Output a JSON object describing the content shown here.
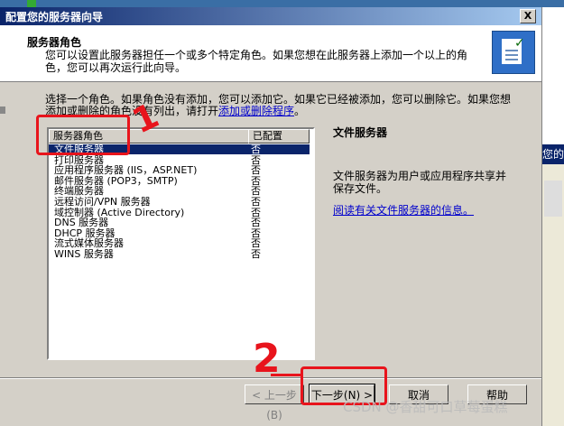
{
  "window": {
    "title": "配置您的服务器向导",
    "close_label": "X"
  },
  "header": {
    "title": "服务器角色",
    "description": "您可以设置此服务器担任一个或多个特定角色。如果您想在此服务器上添加一个以上的角色，您可以再次运行此向导。"
  },
  "intro": {
    "text_before_link": "选择一个角色。如果角色没有添加，您可以添加它。如果它已经被添加，您可以删除它。如果您想添加或删除的角色没有列出，请打开",
    "link_text": "添加或删除程序",
    "text_after_link": "。"
  },
  "roles_list": {
    "col_role": "服务器角色",
    "col_configured": "已配置",
    "rows": [
      {
        "role": "文件服务器",
        "configured": "否"
      },
      {
        "role": "打印服务器",
        "configured": "否"
      },
      {
        "role": "应用程序服务器 (IIS，ASP.NET)",
        "configured": "否"
      },
      {
        "role": "邮件服务器 (POP3，SMTP)",
        "configured": "否"
      },
      {
        "role": "终端服务器",
        "configured": "否"
      },
      {
        "role": "远程访问/VPN 服务器",
        "configured": "否"
      },
      {
        "role": "域控制器 (Active Directory)",
        "configured": "否"
      },
      {
        "role": "DNS 服务器",
        "configured": "否"
      },
      {
        "role": "DHCP 服务器",
        "configured": "否"
      },
      {
        "role": "流式媒体服务器",
        "configured": "否"
      },
      {
        "role": "WINS 服务器",
        "configured": "否"
      }
    ]
  },
  "detail": {
    "title": "文件服务器",
    "description": "文件服务器为用户或应用程序共享并保存文件。",
    "link": "阅读有关文件服务器的信息。"
  },
  "buttons": {
    "back": "< 上一步(B)",
    "next": "下一步(N) >",
    "cancel": "取消",
    "help": "帮助"
  },
  "annotations": {
    "step1": "1",
    "step2": "2"
  },
  "watermark": "CSDN @香甜可口草莓蛋糕",
  "background_window": {
    "title": "您的"
  },
  "colors": {
    "title_bar": "#0a246a",
    "selection": "#0a246a",
    "annotation_red": "#e8141c",
    "dialog_face": "#d4d0c8",
    "link": "#0000cc"
  }
}
